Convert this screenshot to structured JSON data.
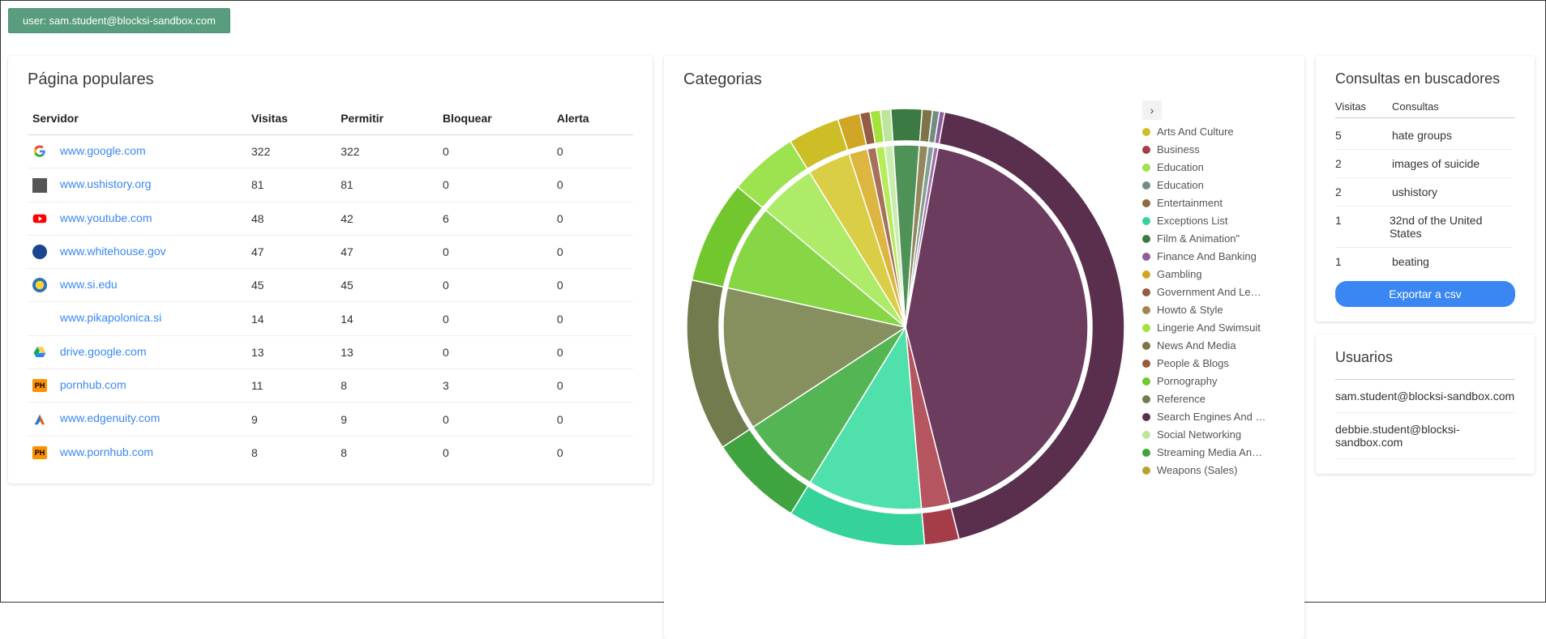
{
  "user_badge": "user: sam.student@blocksi-sandbox.com",
  "popular": {
    "title": "Página populares",
    "headers": {
      "server": "Servidor",
      "visits": "Visitas",
      "allow": "Permitir",
      "block": "Bloquear",
      "alert": "Alerta"
    },
    "rows": [
      {
        "icon": "google",
        "domain": "www.google.com",
        "visits": "322",
        "allow": "322",
        "block": "0",
        "alert": "0"
      },
      {
        "icon": "ushistory",
        "domain": "www.ushistory.org",
        "visits": "81",
        "allow": "81",
        "block": "0",
        "alert": "0"
      },
      {
        "icon": "youtube",
        "domain": "www.youtube.com",
        "visits": "48",
        "allow": "42",
        "block": "6",
        "alert": "0"
      },
      {
        "icon": "whitehouse",
        "domain": "www.whitehouse.gov",
        "visits": "47",
        "allow": "47",
        "block": "0",
        "alert": "0"
      },
      {
        "icon": "si",
        "domain": "www.si.edu",
        "visits": "45",
        "allow": "45",
        "block": "0",
        "alert": "0"
      },
      {
        "icon": "",
        "domain": "www.pikapolonica.si",
        "visits": "14",
        "allow": "14",
        "block": "0",
        "alert": "0"
      },
      {
        "icon": "drive",
        "domain": "drive.google.com",
        "visits": "13",
        "allow": "13",
        "block": "0",
        "alert": "0"
      },
      {
        "icon": "ph",
        "domain": "pornhub.com",
        "visits": "11",
        "allow": "8",
        "block": "3",
        "alert": "0"
      },
      {
        "icon": "edgenuity",
        "domain": "www.edgenuity.com",
        "visits": "9",
        "allow": "9",
        "block": "0",
        "alert": "0"
      },
      {
        "icon": "ph",
        "domain": "www.pornhub.com",
        "visits": "8",
        "allow": "8",
        "block": "0",
        "alert": "0"
      }
    ]
  },
  "categories": {
    "title": "Categorias",
    "nav_icon": "chevron-right",
    "legend": [
      {
        "label": "Arts And Culture",
        "color": "#cdbe27"
      },
      {
        "label": "Business",
        "color": "#a53d49"
      },
      {
        "label": "Education",
        "color": "#9de24f"
      },
      {
        "label": "Education",
        "color": "#6f8e81"
      },
      {
        "label": "Entertainment",
        "color": "#8e6a42"
      },
      {
        "label": "Exceptions List",
        "color": "#35d39a"
      },
      {
        "label": "Film & Animation\"",
        "color": "#3b7a42"
      },
      {
        "label": "Finance And Banking",
        "color": "#8d5e99"
      },
      {
        "label": "Gambling",
        "color": "#cfa625"
      },
      {
        "label": "Government And Le…",
        "color": "#935c43"
      },
      {
        "label": "Howto & Style",
        "color": "#a38550"
      },
      {
        "label": "Lingerie And Swimsuit",
        "color": "#a3e33b"
      },
      {
        "label": "News And Media",
        "color": "#7e7447"
      },
      {
        "label": "People & Blogs",
        "color": "#9a5b36"
      },
      {
        "label": "Pornography",
        "color": "#73c72e"
      },
      {
        "label": "Reference",
        "color": "#727b4d"
      },
      {
        "label": "Search Engines And …",
        "color": "#5a2f4e"
      },
      {
        "label": "Social Networking",
        "color": "#bce69c"
      },
      {
        "label": "Streaming Media An…",
        "color": "#3fa43f"
      },
      {
        "label": "Weapons (Sales)",
        "color": "#b7a22e"
      }
    ]
  },
  "chart_data": {
    "type": "pie",
    "title": "Categorias",
    "series_outer": [
      {
        "name": "Search Engines And …",
        "value": 340,
        "color": "#5a2f4e"
      },
      {
        "name": "Business",
        "value": 20,
        "color": "#a53d49"
      },
      {
        "name": "Exceptions List",
        "value": 80,
        "color": "#35d39a"
      },
      {
        "name": "Streaming Media An…",
        "value": 55,
        "color": "#3fa43f"
      },
      {
        "name": "Reference",
        "value": 100,
        "color": "#727b4d"
      },
      {
        "name": "Pornography",
        "value": 60,
        "color": "#73c72e"
      },
      {
        "name": "Education",
        "value": 40,
        "color": "#9de24f"
      },
      {
        "name": "Arts And Culture",
        "value": 30,
        "color": "#cdbe27"
      },
      {
        "name": "Gambling",
        "value": 13,
        "color": "#cfa625"
      },
      {
        "name": "Government And Le…",
        "value": 6,
        "color": "#935c43"
      },
      {
        "name": "Lingerie And Swimsuit",
        "value": 6,
        "color": "#a3e33b"
      },
      {
        "name": "Social Networking",
        "value": 6,
        "color": "#bce69c"
      },
      {
        "name": "Film & Animation\"",
        "value": 18,
        "color": "#3b7a42"
      },
      {
        "name": "News And Media",
        "value": 6,
        "color": "#7e7447"
      },
      {
        "name": "Education",
        "value": 4,
        "color": "#6f8e81"
      },
      {
        "name": "Finance And Banking",
        "value": 3,
        "color": "#8d5e99"
      }
    ],
    "series_inner": [
      {
        "name": "Search Engines And …",
        "value": 340,
        "color": "#6b3c5e"
      },
      {
        "name": "Business",
        "value": 20,
        "color": "#b55560"
      },
      {
        "name": "Exceptions List",
        "value": 80,
        "color": "#4fe0ab"
      },
      {
        "name": "Streaming Media An…",
        "value": 55,
        "color": "#53b553"
      },
      {
        "name": "Reference",
        "value": 100,
        "color": "#86905f"
      },
      {
        "name": "Pornography",
        "value": 60,
        "color": "#86d645"
      },
      {
        "name": "Education",
        "value": 40,
        "color": "#adeb68"
      },
      {
        "name": "Arts And Culture",
        "value": 30,
        "color": "#dace46"
      },
      {
        "name": "Gambling",
        "value": 13,
        "color": "#dcb63f"
      },
      {
        "name": "Government And Le…",
        "value": 6,
        "color": "#a6705a"
      },
      {
        "name": "Lingerie And Swimsuit",
        "value": 6,
        "color": "#b5ec58"
      },
      {
        "name": "Social Networking",
        "value": 6,
        "color": "#caedaf"
      },
      {
        "name": "Film & Animation\"",
        "value": 18,
        "color": "#4f9257"
      },
      {
        "name": "News And Media",
        "value": 6,
        "color": "#92885c"
      },
      {
        "name": "Education",
        "value": 4,
        "color": "#839f93"
      },
      {
        "name": "Finance And Banking",
        "value": 3,
        "color": "#a074ac"
      }
    ]
  },
  "search_queries": {
    "title": "Consultas en buscadores",
    "headers": {
      "visits": "Visitas",
      "query": "Consultas"
    },
    "rows": [
      {
        "visits": "5",
        "query": "hate groups"
      },
      {
        "visits": "2",
        "query": "images of suicide"
      },
      {
        "visits": "2",
        "query": "ushistory"
      },
      {
        "visits": "1",
        "query": "32nd of the United States"
      },
      {
        "visits": "1",
        "query": "beating"
      }
    ],
    "export_btn": "Exportar a csv"
  },
  "users": {
    "title": "Usuarios",
    "list": [
      "sam.student@blocksi-sandbox.com",
      "debbie.student@blocksi-sandbox.com"
    ]
  }
}
